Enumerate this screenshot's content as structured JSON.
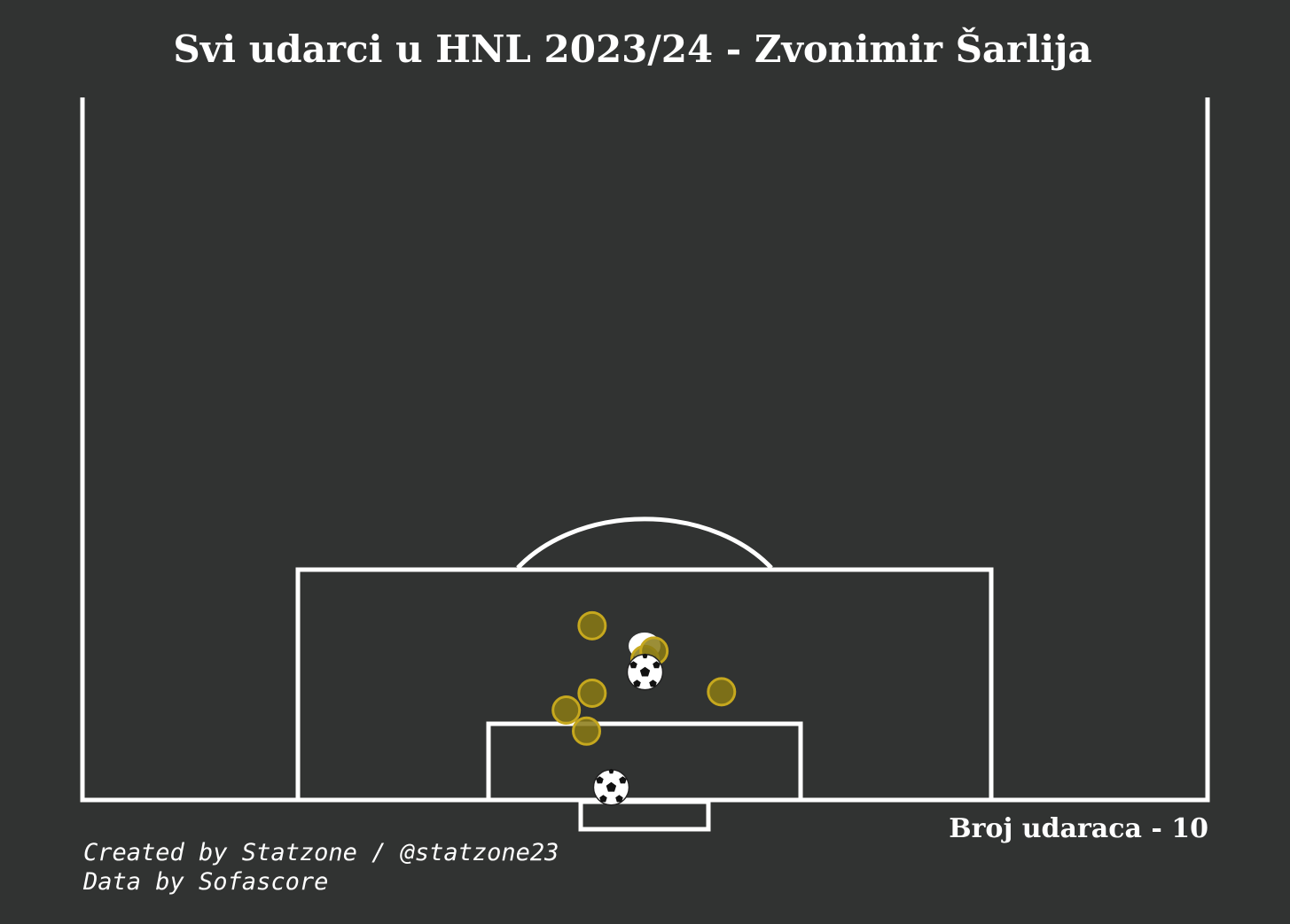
{
  "header": {
    "title": "Svi udarci u HNL 2023/24 - Zvonimir Šarlija"
  },
  "footer": {
    "shot_count_label": "Broj udaraca - 10",
    "credit_line": "Created by Statzone / @statzone23",
    "data_source_line": "Data by Sofascore"
  },
  "colors": {
    "background": "#313332",
    "pitch_lines": "#ffffff",
    "shot_fill": "#8a7a14",
    "shot_edge": "#c6a81e"
  },
  "chart_data": {
    "type": "scatter",
    "title": "Svi udarci u HNL 2023/24 - Zvonimir Šarlija",
    "pitch": "opta-half-pitch-vertical",
    "x_axis": "pitch width (0-100, left to right)",
    "y_axis": "distance from goal line (0-50)",
    "total_shots": 10,
    "shots": [
      {
        "x": 45.3,
        "y": 12.4,
        "outcome": "miss"
      },
      {
        "x": 50.0,
        "y": 10.0,
        "outcome": "miss"
      },
      {
        "x": 50.8,
        "y": 10.6,
        "outcome": "miss"
      },
      {
        "x": 45.3,
        "y": 7.6,
        "outcome": "miss"
      },
      {
        "x": 43.0,
        "y": 6.4,
        "outcome": "miss"
      },
      {
        "x": 44.8,
        "y": 4.9,
        "outcome": "miss"
      },
      {
        "x": 56.8,
        "y": 7.7,
        "outcome": "miss"
      },
      {
        "x": 50.0,
        "y": 9.1,
        "outcome": "goal"
      },
      {
        "x": 47.0,
        "y": 0.9,
        "outcome": "goal"
      }
    ],
    "penalty_spot": {
      "x": 50.0,
      "y": 11.5
    }
  }
}
